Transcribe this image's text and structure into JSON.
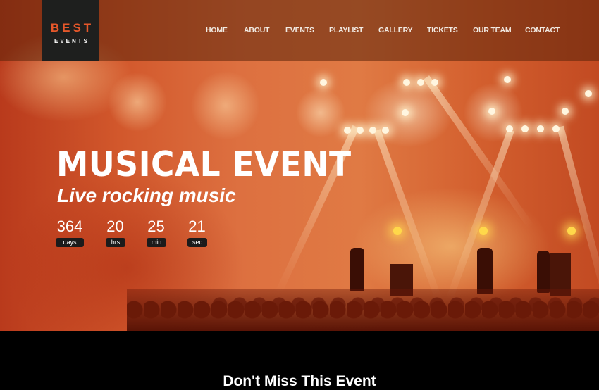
{
  "logo": {
    "line1": "BEST",
    "line2": "EVENTS"
  },
  "nav": {
    "items": [
      {
        "label": "HOME"
      },
      {
        "label": "ABOUT"
      },
      {
        "label": "EVENTS"
      },
      {
        "label": "PLAYLIST"
      },
      {
        "label": "GALLERY"
      },
      {
        "label": "TICKETS"
      },
      {
        "label": "OUR TEAM"
      },
      {
        "label": "CONTACT"
      }
    ]
  },
  "hero": {
    "title": "MUSICAL EVENT",
    "subtitle": "Live rocking music",
    "countdown": [
      {
        "value": "364",
        "unit": "days"
      },
      {
        "value": "20",
        "unit": "hrs"
      },
      {
        "value": "25",
        "unit": "min"
      },
      {
        "value": "21",
        "unit": "sec"
      }
    ]
  },
  "section": {
    "title": "Don't Miss This Event"
  },
  "colors": {
    "accent": "#e5572a",
    "logo_bg": "#1e1f1e",
    "label_bg": "#1b1b1b"
  }
}
